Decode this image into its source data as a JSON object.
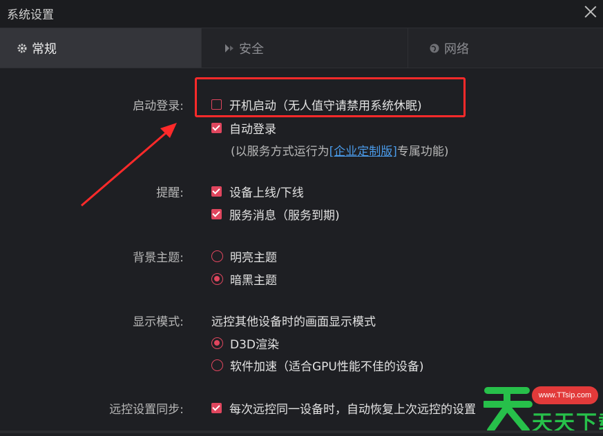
{
  "window": {
    "title": "系统设置"
  },
  "tabs": [
    {
      "label": "常规",
      "icon": "gear-icon",
      "active": true
    },
    {
      "label": "安全",
      "icon": "shield-icon",
      "active": false
    },
    {
      "label": "网络",
      "icon": "globe-icon",
      "active": false
    }
  ],
  "startup": {
    "label": "启动登录:",
    "boot_start": {
      "label": "开机启动（无人值守请禁用系统休眠)",
      "checked": false
    },
    "auto_login": {
      "label": "自动登录",
      "checked": true
    },
    "note_prefix": "(以服务方式运行为",
    "note_link": "[企业定制版]",
    "note_suffix": "专属功能)"
  },
  "remind": {
    "label": "提醒:",
    "device_online": {
      "label": "设备上线/下线",
      "checked": true
    },
    "service_msg": {
      "label": "服务消息（服务到期)",
      "checked": true
    }
  },
  "theme": {
    "label": "背景主题:",
    "light": {
      "label": "明亮主题",
      "selected": false
    },
    "dark": {
      "label": "暗黑主题",
      "selected": true
    }
  },
  "display": {
    "label": "显示模式:",
    "desc": "远控其他设备时的画面显示模式",
    "d3d": {
      "label": "D3D渲染",
      "selected": true
    },
    "soft": {
      "label": "软件加速（适合GPU性能不佳的设备)",
      "selected": false
    }
  },
  "sync": {
    "label": "远控设置同步:",
    "restore": {
      "label": "每次远控同一设备时，自动恢复上次远控的设置",
      "checked": true
    }
  },
  "watermark": {
    "url": "www.TTsip.com",
    "text": "天天下载"
  },
  "colors": {
    "accent": "#e0465e",
    "link": "#4a9ae8",
    "highlight": "#ff2a2a"
  }
}
